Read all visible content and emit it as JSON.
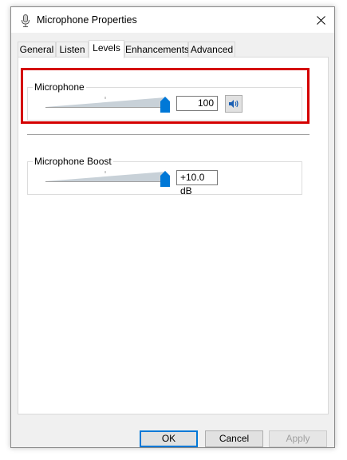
{
  "window": {
    "title": "Microphone Properties"
  },
  "tabs": [
    {
      "label": "General"
    },
    {
      "label": "Listen"
    },
    {
      "label": "Levels",
      "active": true
    },
    {
      "label": "Enhancements"
    },
    {
      "label": "Advanced"
    }
  ],
  "levels": {
    "microphone": {
      "label": "Microphone",
      "value": "100",
      "level_percent": 100,
      "mute_icon": "speaker-icon"
    },
    "boost": {
      "label": "Microphone Boost",
      "value": "+10.0 dB",
      "level_percent": 100
    }
  },
  "buttons": {
    "ok": "OK",
    "cancel": "Cancel",
    "apply": "Apply"
  },
  "colors": {
    "highlight": "#d40000",
    "accent": "#0078d7",
    "thumb": "#0078d7"
  }
}
